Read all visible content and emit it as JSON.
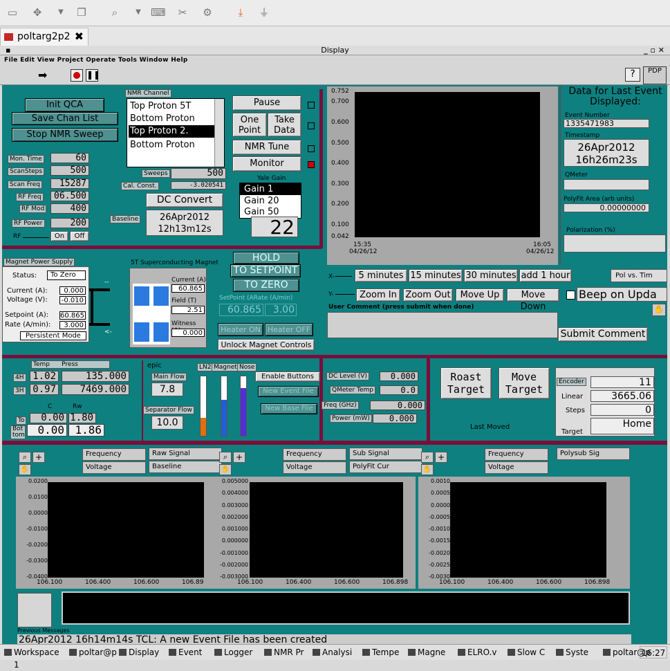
{
  "browser": {
    "tab_title": "poltarg2p2",
    "tab_close": "✖"
  },
  "window": {
    "title": "Display",
    "pdp": "PDP",
    "help": "?"
  },
  "menu": [
    "File",
    "Edit",
    "View",
    "Project",
    "Operate",
    "Tools",
    "Window",
    "Help"
  ],
  "qca": {
    "init": "Init QCA",
    "save": "Save Chan List",
    "stop": "Stop NMR Sweep"
  },
  "nmr": {
    "label": "NMR Channel",
    "channels": [
      "Top Proton 5T",
      "Bottom Proton",
      "Top Proton 2.",
      "Bottom Proton"
    ],
    "selected": 2
  },
  "right_buttons": {
    "pause": "Pause",
    "one_point": "One Point",
    "take_data": "Take Data",
    "nmr_tune": "NMR Tune",
    "monitor": "Monitor"
  },
  "params": [
    {
      "label": "Mon. Time",
      "value": "60"
    },
    {
      "label": "ScanSteps",
      "value": "500"
    },
    {
      "label": "Scan Freq",
      "value": "15287"
    },
    {
      "label": "RF Freq",
      "value": "06.500"
    },
    {
      "label": "RF Mod",
      "value": "400"
    },
    {
      "label": "RF Power",
      "value": "200"
    }
  ],
  "rf": {
    "label": "RF",
    "on": "On",
    "off": "Off"
  },
  "sweeps": {
    "label": "Sweeps",
    "value": "500"
  },
  "cal": {
    "label": "Cal. Const.",
    "value": "-3.020541"
  },
  "yale": {
    "label": "Yale Gain",
    "options": [
      "Gain 1",
      "Gain 20",
      "Gain 50"
    ],
    "value": "22"
  },
  "dc_convert": "DC Convert",
  "baseline": {
    "label": "Baseline",
    "date": "26Apr2012",
    "time": "12h13m12s"
  },
  "strip": {
    "yticks": [
      "0.752",
      "0.700",
      "0.600",
      "0.500",
      "0.400",
      "0.300",
      "0.200",
      "0.100",
      "0.042"
    ],
    "x_start": "15:35",
    "x_start_date": "04/26/12",
    "x_end": "16:05",
    "x_end_date": "04/26/12"
  },
  "event": {
    "heading": "Data for Last Event Displayed:",
    "number_label": "Event Number",
    "number": "1335471983",
    "timestamp_label": "Timestamp",
    "date": "26Apr2012",
    "time": "16h26m23s",
    "qmeter_label": "QMeter",
    "polyfit_label": "PolyFit Area (arb units)",
    "polyfit": "0.00000000",
    "polarization_label": "Polarization (%)"
  },
  "xaxis": {
    "label": "X-",
    "buttons": [
      "5 minutes",
      "15 minutes",
      "30 minutes",
      "add 1 hour"
    ],
    "pol": "Pol vs. Tim"
  },
  "yaxis": {
    "label": "Y-",
    "buttons": [
      "Zoom In",
      "Zoom Out",
      "Move Up",
      "Move Down"
    ],
    "beep": "Beep on Upda"
  },
  "comment": {
    "label": "User Comment (press submit when done)",
    "submit": "Submit Comment"
  },
  "magnet_ps": {
    "title": "Magnet Power Supply",
    "status_label": "Status:",
    "status": "To Zero",
    "current_label": "Current (A):",
    "current": "0.000",
    "voltage_label": "Voltage (V):",
    "voltage": "-0.010",
    "setpoint_label": "Setpoint (A):",
    "setpoint": "60.865",
    "rate_label": "Rate (A/min):",
    "rate": "3.000",
    "mode": "Persistent Mode"
  },
  "sc_magnet": {
    "title": "5T Superconducting Magnet",
    "current_label": "Current (A)",
    "current": "60.865",
    "field_label": "Field (T)",
    "field": "2.51",
    "witness_label": "Witness (A)",
    "witness": "0.000"
  },
  "magnet_ctrl": {
    "hold": "HOLD",
    "to_setpoint": "TO SETPOINT",
    "to_zero": "TO ZERO",
    "setpoint_label": "SetPoint (ARate (A/min)",
    "setpoint": "60.865",
    "rate": "3.00",
    "heater_on": "Heater ON",
    "heater_off": "Heater OFF",
    "unlock": "Unlock Magnet Controls"
  },
  "temps": {
    "temp": "Temp",
    "press": "Press",
    "rows": [
      {
        "l": "4H",
        "t": "1.02",
        "p": "135.000"
      },
      {
        "l": "3H",
        "t": "0.97",
        "p": "7469.000"
      }
    ],
    "c": "C",
    "rw": "Rw",
    "to_label": "To",
    "to_c": "0.00",
    "to_rw": "1.80",
    "bot_label": "Bot tom",
    "bot_c": "0.00",
    "bot_rw": "1.86"
  },
  "flow": {
    "epic": "epic",
    "main_label": "Main Flow",
    "main": "7.8",
    "sep_label": "Separator Flow",
    "sep": "10.0",
    "bars": [
      "LN2",
      "Magnet",
      "Nose"
    ],
    "levels": [
      0.3,
      0.6,
      0.8
    ]
  },
  "files": {
    "enable": "Enable Buttons",
    "new_event": "New Event File",
    "new_base": "New Base File"
  },
  "dc": {
    "level_label": "DC Level (V)",
    "level": "0.000",
    "qmeter_label": "QMeter Temp",
    "qmeter": "0.0",
    "freq_label": "Freq (GHz)",
    "freq": "0.000",
    "power_label": "Power (mW)",
    "power": "0.000"
  },
  "target": {
    "roast": "Roast Target",
    "move": "Move Target",
    "last": "Last Moved",
    "encoder_label": "Encoder",
    "encoder": "11",
    "linear_label": "Linear",
    "linear": "3665.06",
    "steps_label": "Steps",
    "steps": "0",
    "target_label": "Target",
    "target": "Home"
  },
  "graphs": [
    {
      "legend1": "Frequency",
      "legend2": "Voltage",
      "sig1": "Raw Signal",
      "sig2": "Baseline",
      "yticks": [
        "0.0200",
        "0.0100",
        "0.0000",
        "-0.0100",
        "-0.0200",
        "-0.0300",
        "-0.0400"
      ],
      "xticks": [
        "106.100",
        "106.400",
        "106.600",
        "106.89"
      ]
    },
    {
      "legend1": "Frequency",
      "legend2": "Voltage",
      "sig1": "Sub Signal",
      "sig2": "PolyFit Cur",
      "yticks": [
        "0.005000",
        "0.004000",
        "0.003000",
        "0.002000",
        "0.001000",
        "0.000000",
        "-0.001000",
        "-0.002000",
        "-0.003000"
      ],
      "xticks": [
        "106.100",
        "106.400",
        "106.600",
        "106.898"
      ]
    },
    {
      "legend1": "Frequency",
      "legend2": "Voltage",
      "sig1": "Polysub Sig",
      "sig2": "",
      "yticks": [
        "0.0010",
        "0.0005",
        "0.0000",
        "-0.0005",
        "-0.0010",
        "-0.0015",
        "-0.0020",
        "-0.0025",
        "-0.0030"
      ],
      "xticks": [
        "106.100",
        "106.400",
        "106.600",
        "106.898"
      ]
    }
  ],
  "messages": {
    "label": "Previous Messages",
    "text": "26Apr2012 16h14m14s TCL: A new Event File has been created"
  },
  "taskbar": {
    "items": [
      "Workspace 1",
      "poltar@p",
      "Display",
      "Event",
      "Logger",
      "NMR Pr",
      "Analysi",
      "Tempe",
      "Magne",
      "ELRO.v",
      "Slow C",
      "Syste",
      "poltar@p"
    ],
    "clock": "16:27"
  },
  "colors": {
    "panel": "#0e8080",
    "divider": "#7a0e3a",
    "plot": "#000000",
    "led_on": "#d00000",
    "bar_orange": "#e07010",
    "bar_blue": "#2060d0",
    "bar_violet": "#5030d0"
  }
}
